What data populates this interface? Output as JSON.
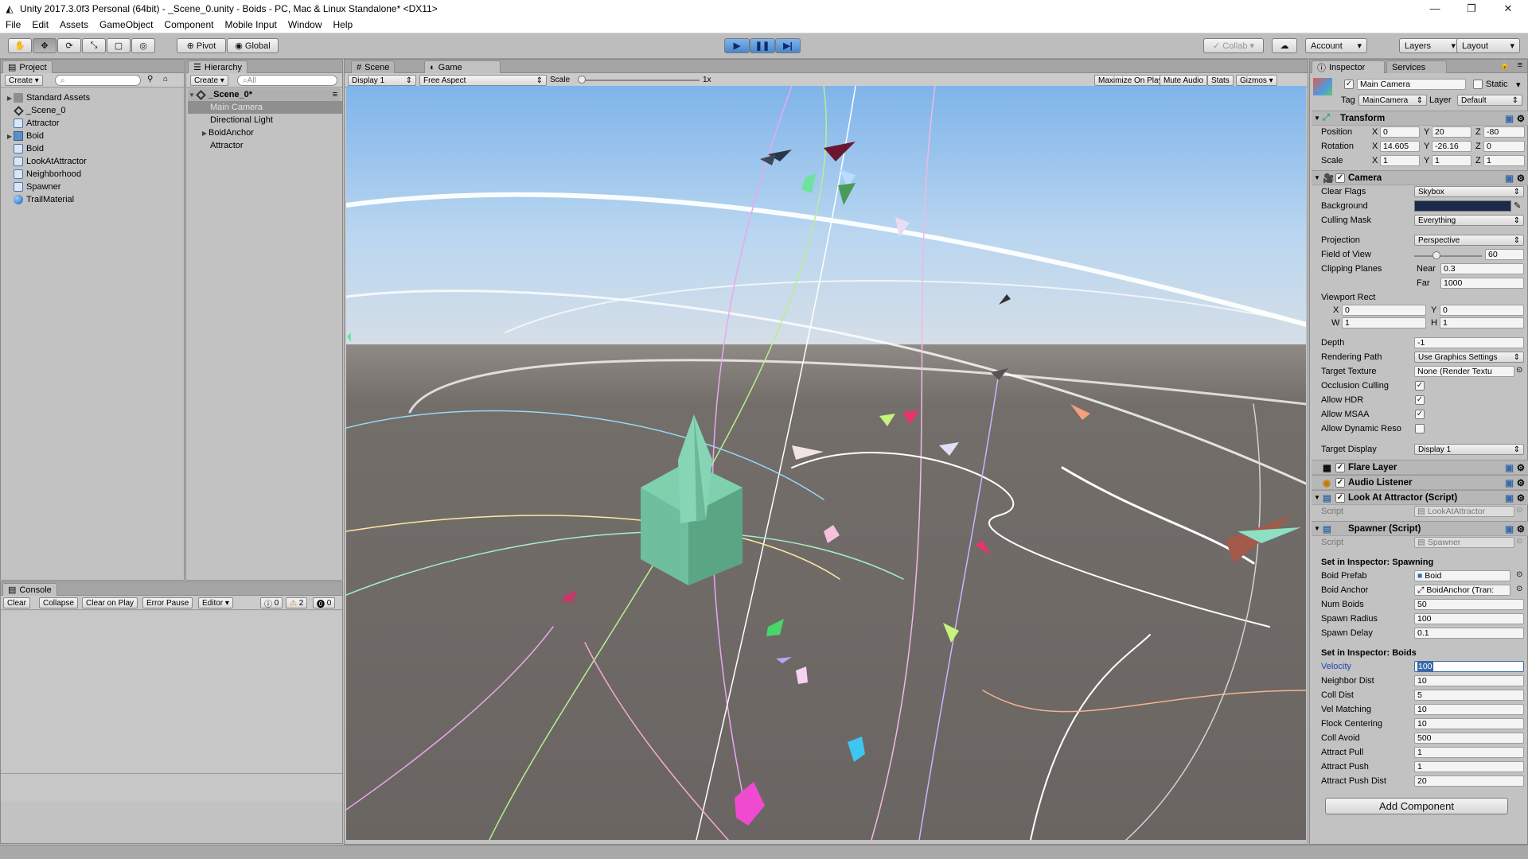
{
  "window": {
    "title": "Unity 2017.3.0f3 Personal (64bit) - _Scene_0.unity - Boids - PC, Mac & Linux Standalone* <DX11>"
  },
  "menu": [
    "File",
    "Edit",
    "Assets",
    "GameObject",
    "Component",
    "Mobile Input",
    "Window",
    "Help"
  ],
  "toolbar": {
    "pivot": "Pivot",
    "global": "Global",
    "collab": "Collab",
    "account": "Account",
    "layers": "Layers",
    "layout": "Layout"
  },
  "project": {
    "tab": "Project",
    "create": "Create",
    "items": [
      "Standard Assets",
      "_Scene_0",
      "Attractor",
      "Boid",
      "Boid",
      "LookAtAttractor",
      "Neighborhood",
      "Spawner",
      "TrailMaterial"
    ]
  },
  "hierarchy": {
    "tab": "Hierarchy",
    "create": "Create",
    "search_placeholder": "All",
    "scene": "_Scene_0*",
    "items": [
      "Main Camera",
      "Directional Light",
      "BoidAnchor",
      "Attractor"
    ]
  },
  "console": {
    "tab": "Console",
    "clear": "Clear",
    "collapse": "Collapse",
    "clear_on_play": "Clear on Play",
    "error_pause": "Error Pause",
    "editor": "Editor",
    "count_info": "0",
    "count_warn": "2",
    "count_error": "0"
  },
  "sceneTab": "Scene",
  "gameTab": "Game",
  "game": {
    "display": "Display 1",
    "aspect": "Free Aspect",
    "scale_label": "Scale",
    "scale_value": "1x",
    "maximize": "Maximize On Play",
    "mute": "Mute Audio",
    "stats": "Stats",
    "gizmos": "Gizmos"
  },
  "inspector": {
    "tab": "Inspector",
    "services_tab": "Services",
    "object_name": "Main Camera",
    "static": "Static",
    "tag_label": "Tag",
    "tag": "MainCamera",
    "layer_label": "Layer",
    "layer": "Default",
    "transform": {
      "title": "Transform",
      "position": {
        "label": "Position",
        "x": "0",
        "y": "20",
        "z": "-80"
      },
      "rotation": {
        "label": "Rotation",
        "x": "14.605",
        "y": "-26.16",
        "z": "0"
      },
      "scale": {
        "label": "Scale",
        "x": "1",
        "y": "1",
        "z": "1"
      }
    },
    "camera": {
      "title": "Camera",
      "clear_flags_label": "Clear Flags",
      "clear_flags": "Skybox",
      "background_label": "Background",
      "background_color": "#1b2a4a",
      "culling_label": "Culling Mask",
      "culling": "Everything",
      "projection_label": "Projection",
      "projection": "Perspective",
      "fov_label": "Field of View",
      "fov": "60",
      "fov_fraction": 0.33,
      "clipping_label": "Clipping Planes",
      "near_label": "Near",
      "near": "0.3",
      "far_label": "Far",
      "far": "1000",
      "viewport_label": "Viewport Rect",
      "vx": "0",
      "vy": "0",
      "vw": "1",
      "vh": "1",
      "depth_label": "Depth",
      "depth": "-1",
      "rendering_label": "Rendering Path",
      "rendering": "Use Graphics Settings",
      "target_tex_label": "Target Texture",
      "target_tex": "None (Render Textu",
      "occlusion_label": "Occlusion Culling",
      "hdr_label": "Allow HDR",
      "msaa_label": "Allow MSAA",
      "dynres_label": "Allow Dynamic Reso",
      "target_display_label": "Target Display",
      "target_display": "Display 1"
    },
    "flare": {
      "title": "Flare Layer"
    },
    "audio": {
      "title": "Audio Listener"
    },
    "lookat": {
      "title": "Look At Attractor (Script)",
      "script_label": "Script",
      "script": "LookAtAttractor"
    },
    "spawner": {
      "title": "Spawner (Script)",
      "script_label": "Script",
      "script": "Spawner",
      "sect_spawning": "Set in Inspector: Spawning",
      "boid_prefab_label": "Boid Prefab",
      "boid_prefab": "Boid",
      "boid_anchor_label": "Boid Anchor",
      "boid_anchor": "BoidAnchor (Tran:",
      "num_boids_label": "Num Boids",
      "num_boids": "50",
      "spawn_radius_label": "Spawn Radius",
      "spawn_radius": "100",
      "spawn_delay_label": "Spawn Delay",
      "spawn_delay": "0.1",
      "sect_boids": "Set in Inspector: Boids",
      "velocity_label": "Velocity",
      "velocity": "100",
      "neighbor_dist_label": "Neighbor Dist",
      "neighbor_dist": "10",
      "coll_dist_label": "Coll Dist",
      "coll_dist": "5",
      "vel_matching_label": "Vel Matching",
      "vel_matching": "10",
      "flock_centering_label": "Flock Centering",
      "flock_centering": "10",
      "coll_avoid_label": "Coll Avoid",
      "coll_avoid": "500",
      "attract_pull_label": "Attract Pull",
      "attract_pull": "1",
      "attract_push_label": "Attract Push",
      "attract_push": "1",
      "attract_push_dist_label": "Attract Push Dist",
      "attract_push_dist": "20"
    },
    "add_component": "Add Component"
  }
}
